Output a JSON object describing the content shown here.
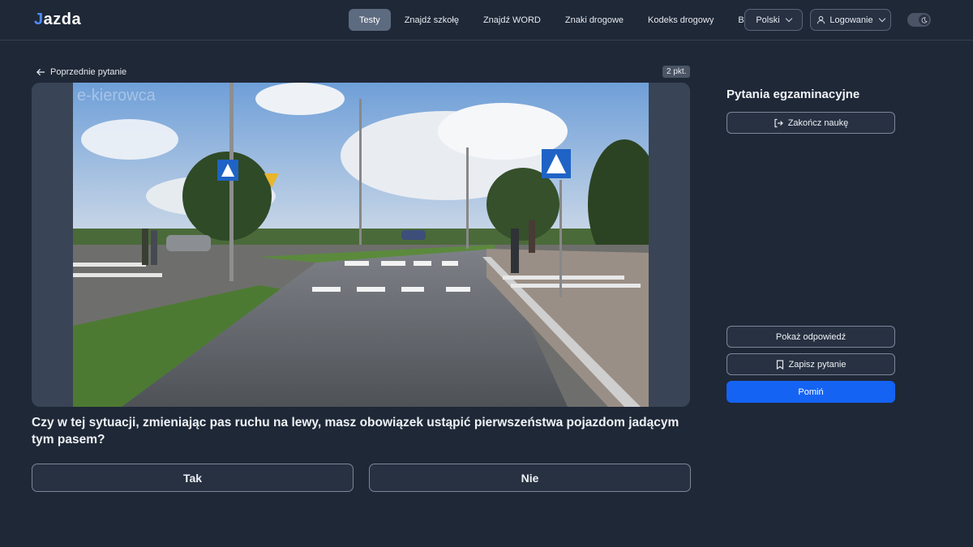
{
  "header": {
    "logo_mark": "J",
    "logo_text": "azda",
    "nav": [
      {
        "label": "Testy",
        "active": true
      },
      {
        "label": "Znajdź szkołę"
      },
      {
        "label": "Znajdź WORD"
      },
      {
        "label": "Znaki drogowe"
      },
      {
        "label": "Kodeks drogowy"
      },
      {
        "label": "Blog"
      }
    ],
    "language_label": "Polski",
    "login_label": "Logowanie",
    "theme": "dark"
  },
  "main": {
    "prev_label": "Poprzednie pytanie",
    "points": "2 pkt.",
    "media_watermark": "e-kierowca",
    "question": "Czy w tej sytuacji, zmieniając pas ruchu na lewy, masz obowiązek ustąpić pierwszeństwa pojazdom jadącym tym pasem?",
    "answers": {
      "yes": "Tak",
      "no": "Nie"
    }
  },
  "sidebar": {
    "title": "Pytania egzaminacyjne",
    "end_label": "Zakończ naukę",
    "show_answer_label": "Pokaż odpowiedź",
    "save_label": "Zapisz pytanie",
    "skip_label": "Pomiń"
  },
  "colors": {
    "background": "#1f2837",
    "accent": "#1463f3",
    "active_nav": "#5d6b80"
  }
}
